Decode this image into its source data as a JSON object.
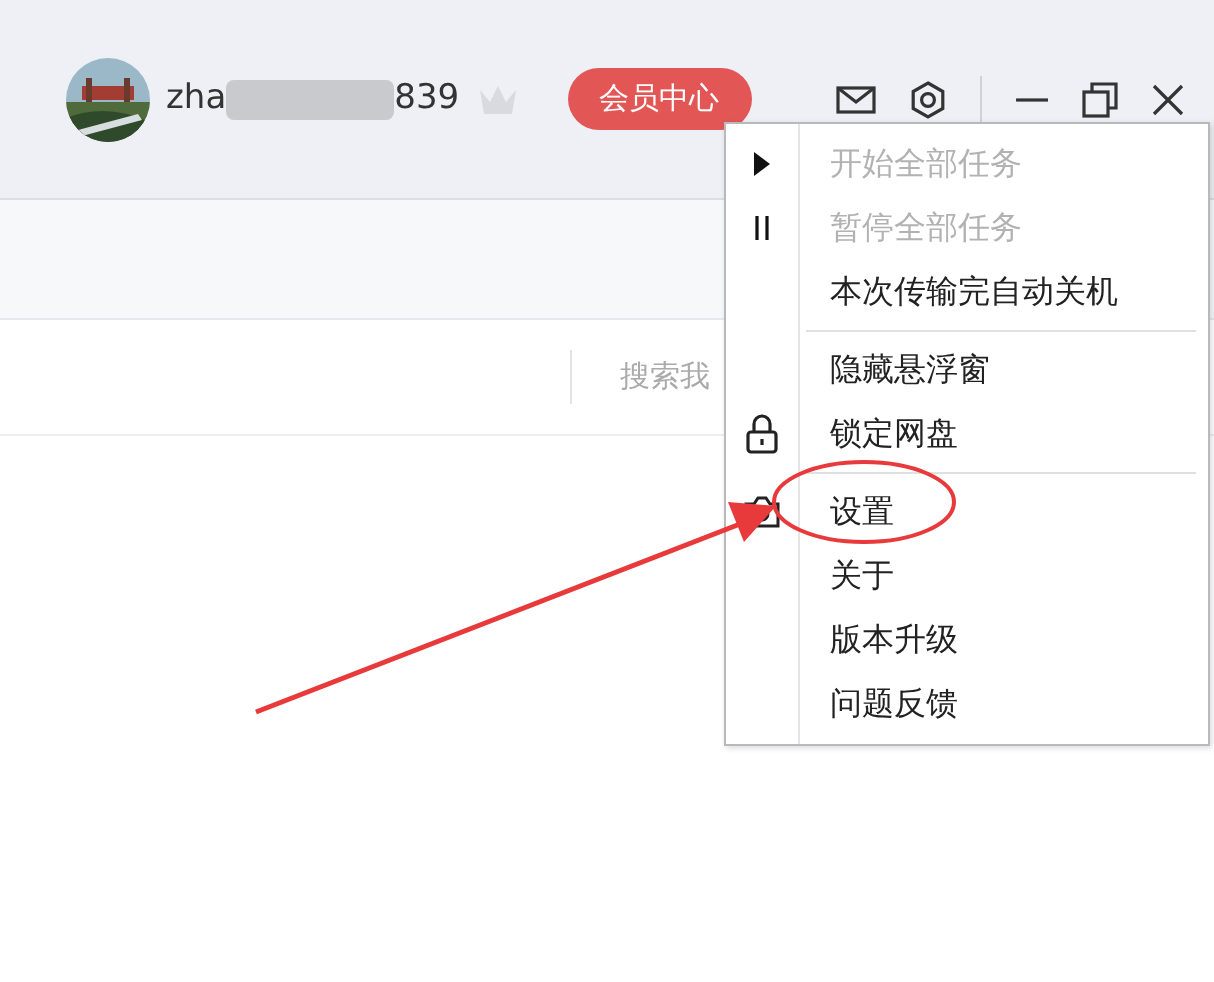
{
  "header": {
    "username_start": "zha",
    "username_end": "839",
    "vip_button": "会员中心"
  },
  "search": {
    "placeholder": "搜索我"
  },
  "menu": {
    "items": [
      {
        "kind": "item",
        "label": "开始全部任务",
        "disabled": true
      },
      {
        "kind": "item",
        "label": "暂停全部任务",
        "disabled": true
      },
      {
        "kind": "item",
        "label": "本次传输完自动关机",
        "disabled": false
      },
      {
        "kind": "divider"
      },
      {
        "kind": "item",
        "label": "隐藏悬浮窗",
        "disabled": false
      },
      {
        "kind": "item",
        "label": "锁定网盘",
        "disabled": false
      },
      {
        "kind": "divider"
      },
      {
        "kind": "item",
        "label": "设置",
        "disabled": false
      },
      {
        "kind": "item",
        "label": "关于",
        "disabled": false
      },
      {
        "kind": "item",
        "label": "版本升级",
        "disabled": false
      },
      {
        "kind": "item",
        "label": "问题反馈",
        "disabled": false
      }
    ]
  }
}
